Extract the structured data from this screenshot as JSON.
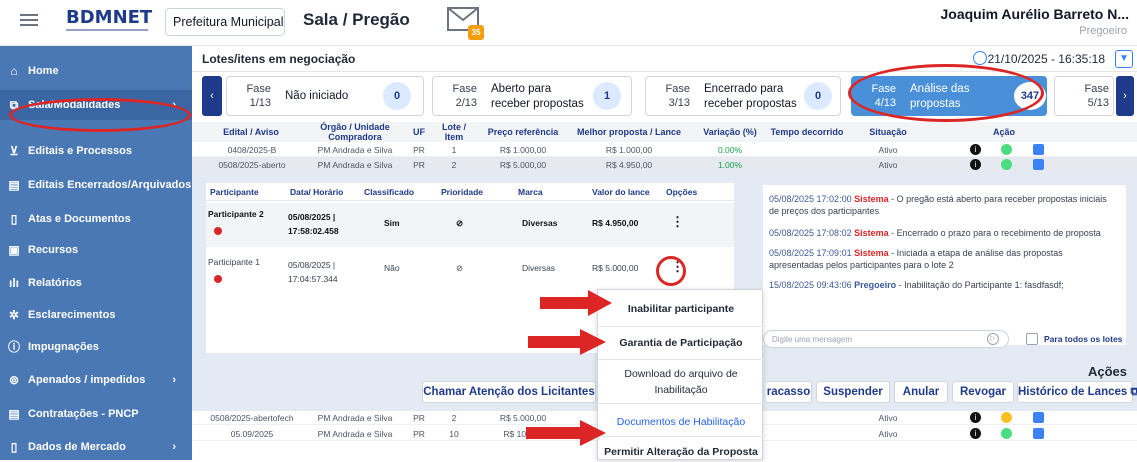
{
  "header": {
    "logo": "BDMNET",
    "organization": "Prefeitura Municipal de...",
    "room_title": "Sala / Pregão",
    "mail_count": "35",
    "user_name": "Joaquim Aurélio Barreto N...",
    "user_role": "Pregoeiro"
  },
  "sidebar": {
    "items": [
      {
        "label": "Home",
        "icon": "home-icon"
      },
      {
        "label": "Sala/Modalidades",
        "icon": "room-icon",
        "arrow": "›"
      },
      {
        "label": "Editais e Processos",
        "icon": "cart-icon"
      },
      {
        "label": "Editais Encerrados/Arquivados",
        "icon": "archive-icon"
      },
      {
        "label": "Atas e Documentos",
        "icon": "document-icon"
      },
      {
        "label": "Recursos",
        "icon": "box-icon"
      },
      {
        "label": "Relatórios",
        "icon": "bar-chart-icon"
      },
      {
        "label": "Esclarecimentos",
        "icon": "sun-icon"
      },
      {
        "label": "Impugnações",
        "icon": "info-icon"
      },
      {
        "label": "Apenados / impedidos",
        "icon": "block-icon",
        "arrow": "›"
      },
      {
        "label": "Contratações - PNCP",
        "icon": "contract-icon"
      },
      {
        "label": "Dados de Mercado",
        "icon": "data-icon",
        "arrow": "›"
      }
    ]
  },
  "lotes": {
    "title": "Lotes/itens em negociação",
    "datetime": "21/10/2025 - 16:35:18"
  },
  "phases": [
    {
      "fase": "Fase\n1/13",
      "label": "Não iniciado",
      "count": "0"
    },
    {
      "fase": "Fase\n2/13",
      "label": "Aberto para\nreceber propostas",
      "count": "1"
    },
    {
      "fase": "Fase\n3/13",
      "label": "Encerrado para\nreceber propostas",
      "count": "0"
    },
    {
      "fase": "Fase\n4/13",
      "label": "Análise das\npropostas",
      "count": "347"
    },
    {
      "fase": "Fase\n5/13",
      "label": "",
      "count": ""
    }
  ],
  "table": {
    "headers": [
      "Edital / Aviso",
      "Órgão / Unidade Compradora",
      "UF",
      "Lote / Item",
      "Preço referência",
      "Melhor proposta / Lance",
      "Variação (%)",
      "Tempo decorrido",
      "Situação",
      "Ação"
    ],
    "rows": [
      [
        "0408/2025-B",
        "PM Andrada e Silva",
        "PR",
        "1",
        "R$ 1.000,00",
        "R$ 1.000,00",
        "0.00%",
        "",
        "Ativo"
      ],
      [
        "0508/2025-aberto",
        "PM Andrada e Silva",
        "PR",
        "2",
        "R$ 5.000,00",
        "R$ 4.950,00",
        "1.00%",
        "",
        "Ativo"
      ]
    ],
    "bottom_rows": [
      [
        "0508/2025-abertofech",
        "PM Andrada e Silva",
        "PR",
        "2",
        "R$ 5.000,00",
        "",
        "",
        "",
        "Ativo"
      ],
      [
        "05.09/2025",
        "PM Andrada e Silva",
        "PR",
        "10",
        "R$ 100,00",
        "",
        "",
        "",
        "Ativo"
      ]
    ]
  },
  "participants": {
    "headers": [
      "Participante",
      "Data/ Horário",
      "Classificado",
      "Prioridade",
      "Marca",
      "Valor do lance",
      "Opções"
    ],
    "rows": [
      {
        "name": "Participante 2",
        "date": "05/08/2025 |",
        "time": "17:58:02.458",
        "classified": "Sim",
        "brand": "Diversas",
        "value": "R$ 4.950,00"
      },
      {
        "name": "Participante 1",
        "date": "05/08/2025 |",
        "time": "17:04:57.344",
        "classified": "Não",
        "brand": "Diversas",
        "value": "R$ 5.000,00"
      }
    ]
  },
  "chat": {
    "messages": [
      {
        "ts": "05/08/2025 17:02:00",
        "who": "Sistema",
        "text": " - O pregão está aberto para receber propostas iniciais de preços dos participantes"
      },
      {
        "ts": "05/08/2025 17:08:02",
        "who": "Sistema",
        "text": " - Encerrado o prazo para o recebimento de proposta"
      },
      {
        "ts": "05/08/2025 17:09:01",
        "who": "Sistema",
        "text": " - Iniciada a etapa de análise das propostas apresentadas pelos participantes para o lote 2"
      },
      {
        "ts": "15/08/2025 09:43:06",
        "who": "Pregoeiro",
        "text": " - Inabilitação do Participante 1: fasdfasdf;"
      }
    ],
    "input_placeholder": "Digite uma mensagem",
    "all_lots_label": "Para todos os lotes"
  },
  "actions": {
    "title": "Ações",
    "buttons": [
      "Chamar Atenção dos Licitantes",
      "racasso",
      "Suspender",
      "Anular",
      "Revogar",
      "Histórico de Lances ⧉"
    ]
  },
  "context_menu": {
    "items": [
      "Inabilitar participante",
      "Garantia de Participação",
      "Download do arquivo de\nInabilitação",
      "Documentos de Habilitação",
      "Permitir Alteração da Proposta"
    ]
  },
  "colors": {
    "sidebar": "#4a78b5",
    "accent": "#1e3a8a",
    "annotation": "#dc2626"
  }
}
